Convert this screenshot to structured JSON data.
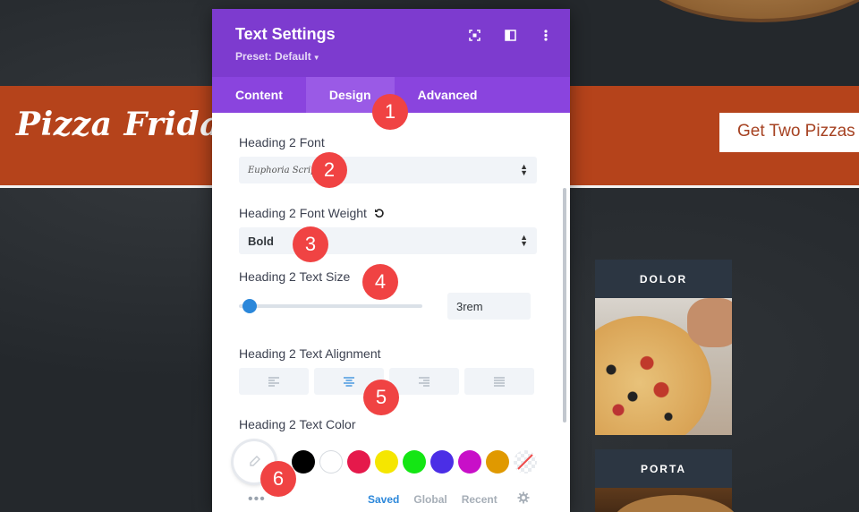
{
  "background": {
    "brand_title": "Pizza Friday",
    "promo_button": "Get Two Pizzas",
    "cards": [
      {
        "heading": "DOLOR"
      },
      {
        "heading": "PORTA"
      }
    ]
  },
  "modal": {
    "title": "Text Settings",
    "preset": "Preset: Default",
    "header_icons": [
      "focus-icon",
      "sidebar-layout-icon",
      "more-vertical-icon"
    ],
    "tabs": [
      {
        "label": "Content",
        "active": false
      },
      {
        "label": "Design",
        "active": true
      },
      {
        "label": "Advanced",
        "active": false
      }
    ],
    "font": {
      "label": "Heading 2 Font",
      "value": "Euphoria Script"
    },
    "weight": {
      "label": "Heading 2 Font Weight",
      "value": "Bold"
    },
    "size": {
      "label": "Heading 2 Text Size",
      "value": "3rem",
      "slider_fraction": 0.02
    },
    "alignment": {
      "label": "Heading 2 Text Alignment",
      "options": [
        "left",
        "center",
        "right",
        "justify"
      ],
      "selected": "center"
    },
    "color": {
      "label": "Heading 2 Text Color",
      "swatches": [
        "#000000",
        "#ffffff",
        "#e02b20",
        "#e09900",
        "#edf000",
        "#7cda24",
        "#0c71c3",
        "#8300e9"
      ],
      "visible_swatches": [
        "#000000",
        "#ffffff",
        "#e5194b",
        "#f5e600",
        "#14e614",
        "#4b2ee6",
        "#c80fc8",
        "#e09900"
      ],
      "palette_tabs": [
        "Saved",
        "Global",
        "Recent"
      ],
      "active_palette": "Saved"
    }
  },
  "steps": [
    "1",
    "2",
    "3",
    "4",
    "5",
    "6"
  ],
  "accent": "#7d3bcf",
  "badge_color": "#f04343"
}
